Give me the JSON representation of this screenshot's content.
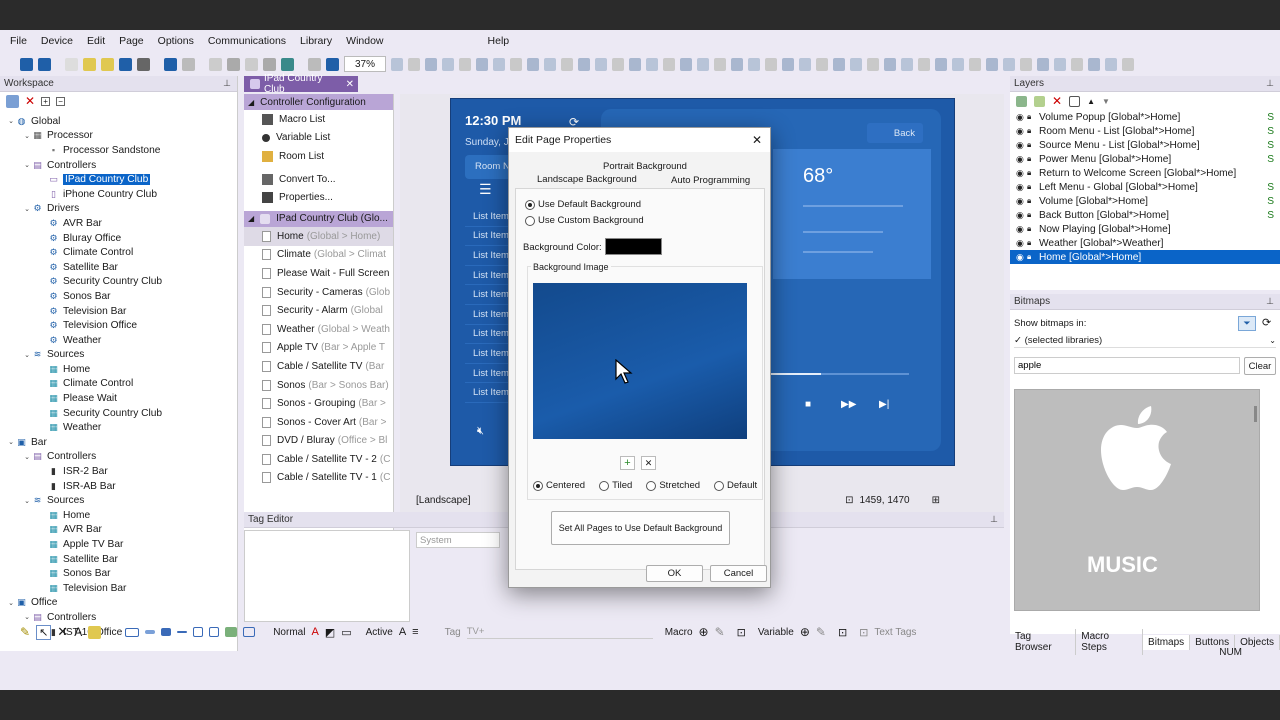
{
  "menu": [
    "File",
    "Device",
    "Edit",
    "Page",
    "Options",
    "Communications",
    "Library",
    "Window",
    "Help"
  ],
  "zoom": "37%",
  "workspace": {
    "title": "Workspace",
    "tree": [
      {
        "label": "Global",
        "level": 0,
        "twisty": "open",
        "icon": "globe-icon"
      },
      {
        "label": "Processor",
        "level": 1,
        "twisty": "open",
        "icon": "processor-icon"
      },
      {
        "label": "Processor Sandstone",
        "level": 2,
        "twisty": "",
        "icon": "chip-icon"
      },
      {
        "label": "Controllers",
        "level": 1,
        "twisty": "open",
        "icon": "controllers-icon"
      },
      {
        "label": "IPad Country Club",
        "level": 2,
        "twisty": "",
        "icon": "tablet-icon",
        "selected": true
      },
      {
        "label": "iPhone Country Club",
        "level": 2,
        "twisty": "",
        "icon": "phone-icon"
      },
      {
        "label": "Drivers",
        "level": 1,
        "twisty": "open",
        "icon": "gear-icon"
      },
      {
        "label": "AVR Bar",
        "level": 2,
        "twisty": "",
        "icon": "gear-icon"
      },
      {
        "label": "Bluray Office",
        "level": 2,
        "twisty": "",
        "icon": "gear-icon"
      },
      {
        "label": "Climate Control",
        "level": 2,
        "twisty": "",
        "icon": "gear-icon"
      },
      {
        "label": "Satellite Bar",
        "level": 2,
        "twisty": "",
        "icon": "gear-icon"
      },
      {
        "label": "Security Country Club",
        "level": 2,
        "twisty": "",
        "icon": "gear-icon"
      },
      {
        "label": "Sonos Bar",
        "level": 2,
        "twisty": "",
        "icon": "gear-icon"
      },
      {
        "label": "Television Bar",
        "level": 2,
        "twisty": "",
        "icon": "gear-icon"
      },
      {
        "label": "Television Office",
        "level": 2,
        "twisty": "",
        "icon": "gear-icon"
      },
      {
        "label": "Weather",
        "level": 2,
        "twisty": "",
        "icon": "gear-icon"
      },
      {
        "label": "Sources",
        "level": 1,
        "twisty": "open",
        "icon": "sources-icon"
      },
      {
        "label": "Home",
        "level": 2,
        "twisty": "",
        "icon": "source-icon"
      },
      {
        "label": "Climate Control",
        "level": 2,
        "twisty": "",
        "icon": "source-icon"
      },
      {
        "label": "Please Wait",
        "level": 2,
        "twisty": "",
        "icon": "source-icon"
      },
      {
        "label": "Security Country Club",
        "level": 2,
        "twisty": "",
        "icon": "source-icon"
      },
      {
        "label": "Weather",
        "level": 2,
        "twisty": "",
        "icon": "source-icon"
      },
      {
        "label": "Bar",
        "level": 0,
        "twisty": "open",
        "icon": "folder-icon"
      },
      {
        "label": "Controllers",
        "level": 1,
        "twisty": "open",
        "icon": "controllers-icon"
      },
      {
        "label": "ISR-2 Bar",
        "level": 2,
        "twisty": "",
        "icon": "remote-icon"
      },
      {
        "label": "ISR-AB Bar",
        "level": 2,
        "twisty": "",
        "icon": "remote-icon"
      },
      {
        "label": "Sources",
        "level": 1,
        "twisty": "open",
        "icon": "sources-icon"
      },
      {
        "label": "Home",
        "level": 2,
        "twisty": "",
        "icon": "source-icon"
      },
      {
        "label": "AVR Bar",
        "level": 2,
        "twisty": "",
        "icon": "source-icon"
      },
      {
        "label": "Apple TV Bar",
        "level": 2,
        "twisty": "",
        "icon": "source-icon"
      },
      {
        "label": "Satellite Bar",
        "level": 2,
        "twisty": "",
        "icon": "source-icon"
      },
      {
        "label": "Sonos Bar",
        "level": 2,
        "twisty": "",
        "icon": "source-icon"
      },
      {
        "label": "Television Bar",
        "level": 2,
        "twisty": "",
        "icon": "source-icon"
      },
      {
        "label": "Office",
        "level": 0,
        "twisty": "open",
        "icon": "folder-icon"
      },
      {
        "label": "Controllers",
        "level": 1,
        "twisty": "open",
        "icon": "controllers-icon"
      },
      {
        "label": "IST-10 Office",
        "level": 2,
        "twisty": "",
        "icon": "remote-icon"
      }
    ]
  },
  "doc_tab": "IPad Country Club",
  "controller_config": {
    "header": "Controller Configuration",
    "items": [
      "Macro List",
      "Variable List",
      "Room List",
      "Convert To...",
      "Properties..."
    ]
  },
  "pages_group": {
    "header": "IPad Country Club (Glo...",
    "pages": [
      {
        "name": "Home",
        "scope": "(Global > Home)"
      },
      {
        "name": "Climate",
        "scope": "(Global > Climat"
      },
      {
        "name": "Please Wait - Full Screen",
        "scope": ""
      },
      {
        "name": "Security - Cameras",
        "scope": "(Glob"
      },
      {
        "name": "Security - Alarm",
        "scope": "(Global"
      },
      {
        "name": "Weather",
        "scope": "(Global > Weath"
      },
      {
        "name": "Apple TV",
        "scope": "(Bar > Apple T"
      },
      {
        "name": "Cable / Satellite TV",
        "scope": "(Bar"
      },
      {
        "name": "Sonos",
        "scope": "(Bar > Sonos Bar)"
      },
      {
        "name": "Sonos - Grouping",
        "scope": "(Bar >"
      },
      {
        "name": "Sonos - Cover Art",
        "scope": "(Bar >"
      },
      {
        "name": "DVD / Bluray",
        "scope": "(Office > Bl"
      },
      {
        "name": "Cable / Satellite TV - 2",
        "scope": "(C"
      },
      {
        "name": "Cable / Satellite TV - 1",
        "scope": "(C"
      }
    ]
  },
  "device": {
    "time": "12:30 PM",
    "date": "Sunday, J",
    "room_label": "Room N",
    "back_label": "Back",
    "temp": "68°",
    "list_items": [
      "List Item",
      "List Item",
      "List Item",
      "List Item",
      "List Item",
      "List Item",
      "List Item",
      "List Item",
      "List Item",
      "List Item"
    ]
  },
  "canvas_status": {
    "orientation": "[Landscape]",
    "coords": "1459, 1470"
  },
  "tag_editor": {
    "title": "Tag Editor",
    "system_placeholder": "System"
  },
  "dialog": {
    "title": "Edit Page Properties",
    "tabs": {
      "portrait": "Portrait Background",
      "landscape": "Landscape Background",
      "auto": "Auto Programming"
    },
    "use_default": "Use Default Background",
    "use_custom": "Use Custom Background",
    "bg_color_label": "Background Color:",
    "bg_color": "#000000",
    "bg_image_label": "Background Image",
    "placements": [
      "Centered",
      "Tiled",
      "Stretched",
      "Default"
    ],
    "set_all": "Set All Pages to Use Default Background",
    "ok": "OK",
    "cancel": "Cancel"
  },
  "layers": {
    "title": "Layers",
    "items": [
      {
        "label": "Volume Popup [Global*>Home]",
        "s": "S"
      },
      {
        "label": "Room Menu - List [Global*>Home]",
        "s": "S"
      },
      {
        "label": "Source Menu - List [Global*>Home]",
        "s": "S"
      },
      {
        "label": "Power Menu [Global*>Home]",
        "s": "S"
      },
      {
        "label": "Return to Welcome Screen [Global*>Home]",
        "s": ""
      },
      {
        "label": "Left Menu - Global [Global*>Home]",
        "s": "S"
      },
      {
        "label": "Volume [Global*>Home]",
        "s": "S"
      },
      {
        "label": "Back Button [Global*>Home]",
        "s": "S"
      },
      {
        "label": "Now Playing [Global*>Home]",
        "s": ""
      },
      {
        "label": "Weather [Global*>Weather]",
        "s": ""
      },
      {
        "label": "Home [Global*>Home]",
        "s": "",
        "selected": true
      }
    ]
  },
  "bitmaps": {
    "title": "Bitmaps",
    "show_in_label": "Show bitmaps in:",
    "library": "✓ (selected libraries)",
    "search_value": "apple",
    "clear": "Clear",
    "preview_text": "MUSIC"
  },
  "bottom_tabs": [
    "Tag Browser",
    "Macro Steps",
    "Bitmaps",
    "Buttons",
    "Objects"
  ],
  "bottom_toolbar": {
    "normal": "Normal",
    "active": "Active",
    "tag": "Tag",
    "tag_value": "TV+",
    "macro": "Macro",
    "variable": "Variable",
    "text_tags": "Text Tags"
  },
  "status": {
    "num": "NUM"
  },
  "colors": {
    "accent_purple": "#7d5da8",
    "selection_blue": "#0a64c8",
    "device_blue": "#1e5aa8"
  }
}
